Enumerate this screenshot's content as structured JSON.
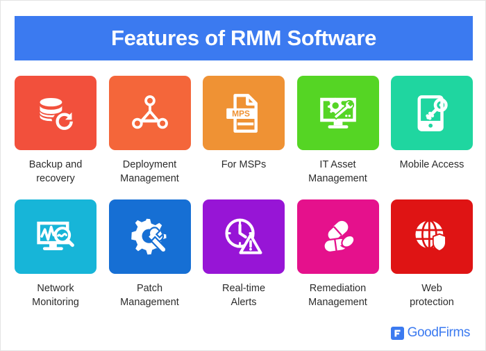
{
  "header": {
    "title": "Features of RMM Software",
    "banner_color": "#3b7af0",
    "title_color": "#ffffff"
  },
  "features": [
    {
      "label": "Backup and\nrecovery",
      "icon": "database-restore-icon",
      "color": "#f2503c"
    },
    {
      "label": "Deployment\nManagement",
      "icon": "network-nodes-icon",
      "color": "#f4663a"
    },
    {
      "label": "For MSPs",
      "icon": "mps-document-icon",
      "icon_text": "MPS",
      "color": "#ef9234"
    },
    {
      "label": "IT Asset\nManagement",
      "icon": "monitor-gear-wrench-icon",
      "color": "#55d524"
    },
    {
      "label": "Mobile Access",
      "icon": "mobile-key-icon",
      "color": "#1fd6a0"
    },
    {
      "label": "Network\nMonitoring",
      "icon": "monitor-chart-magnifier-icon",
      "color": "#17b5d8"
    },
    {
      "label": "Patch\nManagement",
      "icon": "gear-wrench-icon",
      "color": "#166fd4"
    },
    {
      "label": "Real-time\nAlerts",
      "icon": "clock-warning-icon",
      "color": "#9715d6"
    },
    {
      "label": "Remediation\nManagement",
      "icon": "pills-capsule-icon",
      "color": "#e5118c"
    },
    {
      "label": "Web\nprotection",
      "icon": "globe-shield-icon",
      "color": "#df1414"
    }
  ],
  "footer": {
    "brand": "GoodFirms",
    "brand_color": "#3b7af0",
    "logo_icon": "goodfirms-logo-icon"
  }
}
